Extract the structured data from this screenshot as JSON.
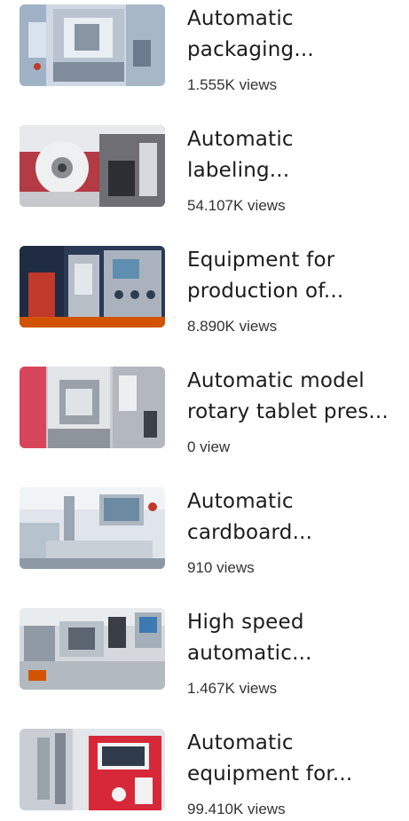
{
  "videos": [
    {
      "title_line1": "Automatic",
      "title_line2": "packaging...",
      "views": "1.555K views",
      "thumb_icon": "packaging-machine-thumbnail"
    },
    {
      "title_line1": "Automatic",
      "title_line2": "labeling...",
      "views": "54.107K views",
      "thumb_icon": "labeling-machine-thumbnail"
    },
    {
      "title_line1": "Equipment for",
      "title_line2": "production of...",
      "views": "8.890K views",
      "thumb_icon": "production-equipment-thumbnail"
    },
    {
      "title_line1": "Automatic model",
      "title_line2": "rotary tablet pres...",
      "views": "0 view",
      "thumb_icon": "tablet-press-thumbnail"
    },
    {
      "title_line1": "Automatic",
      "title_line2": "cardboard...",
      "views": "910 views",
      "thumb_icon": "cardboard-machine-thumbnail"
    },
    {
      "title_line1": "High speed",
      "title_line2": "automatic...",
      "views": "1.467K views",
      "thumb_icon": "high-speed-machine-thumbnail"
    },
    {
      "title_line1": "Automatic",
      "title_line2": "equipment for...",
      "views": "99.410K views",
      "thumb_icon": "automatic-equipment-thumbnail"
    }
  ]
}
